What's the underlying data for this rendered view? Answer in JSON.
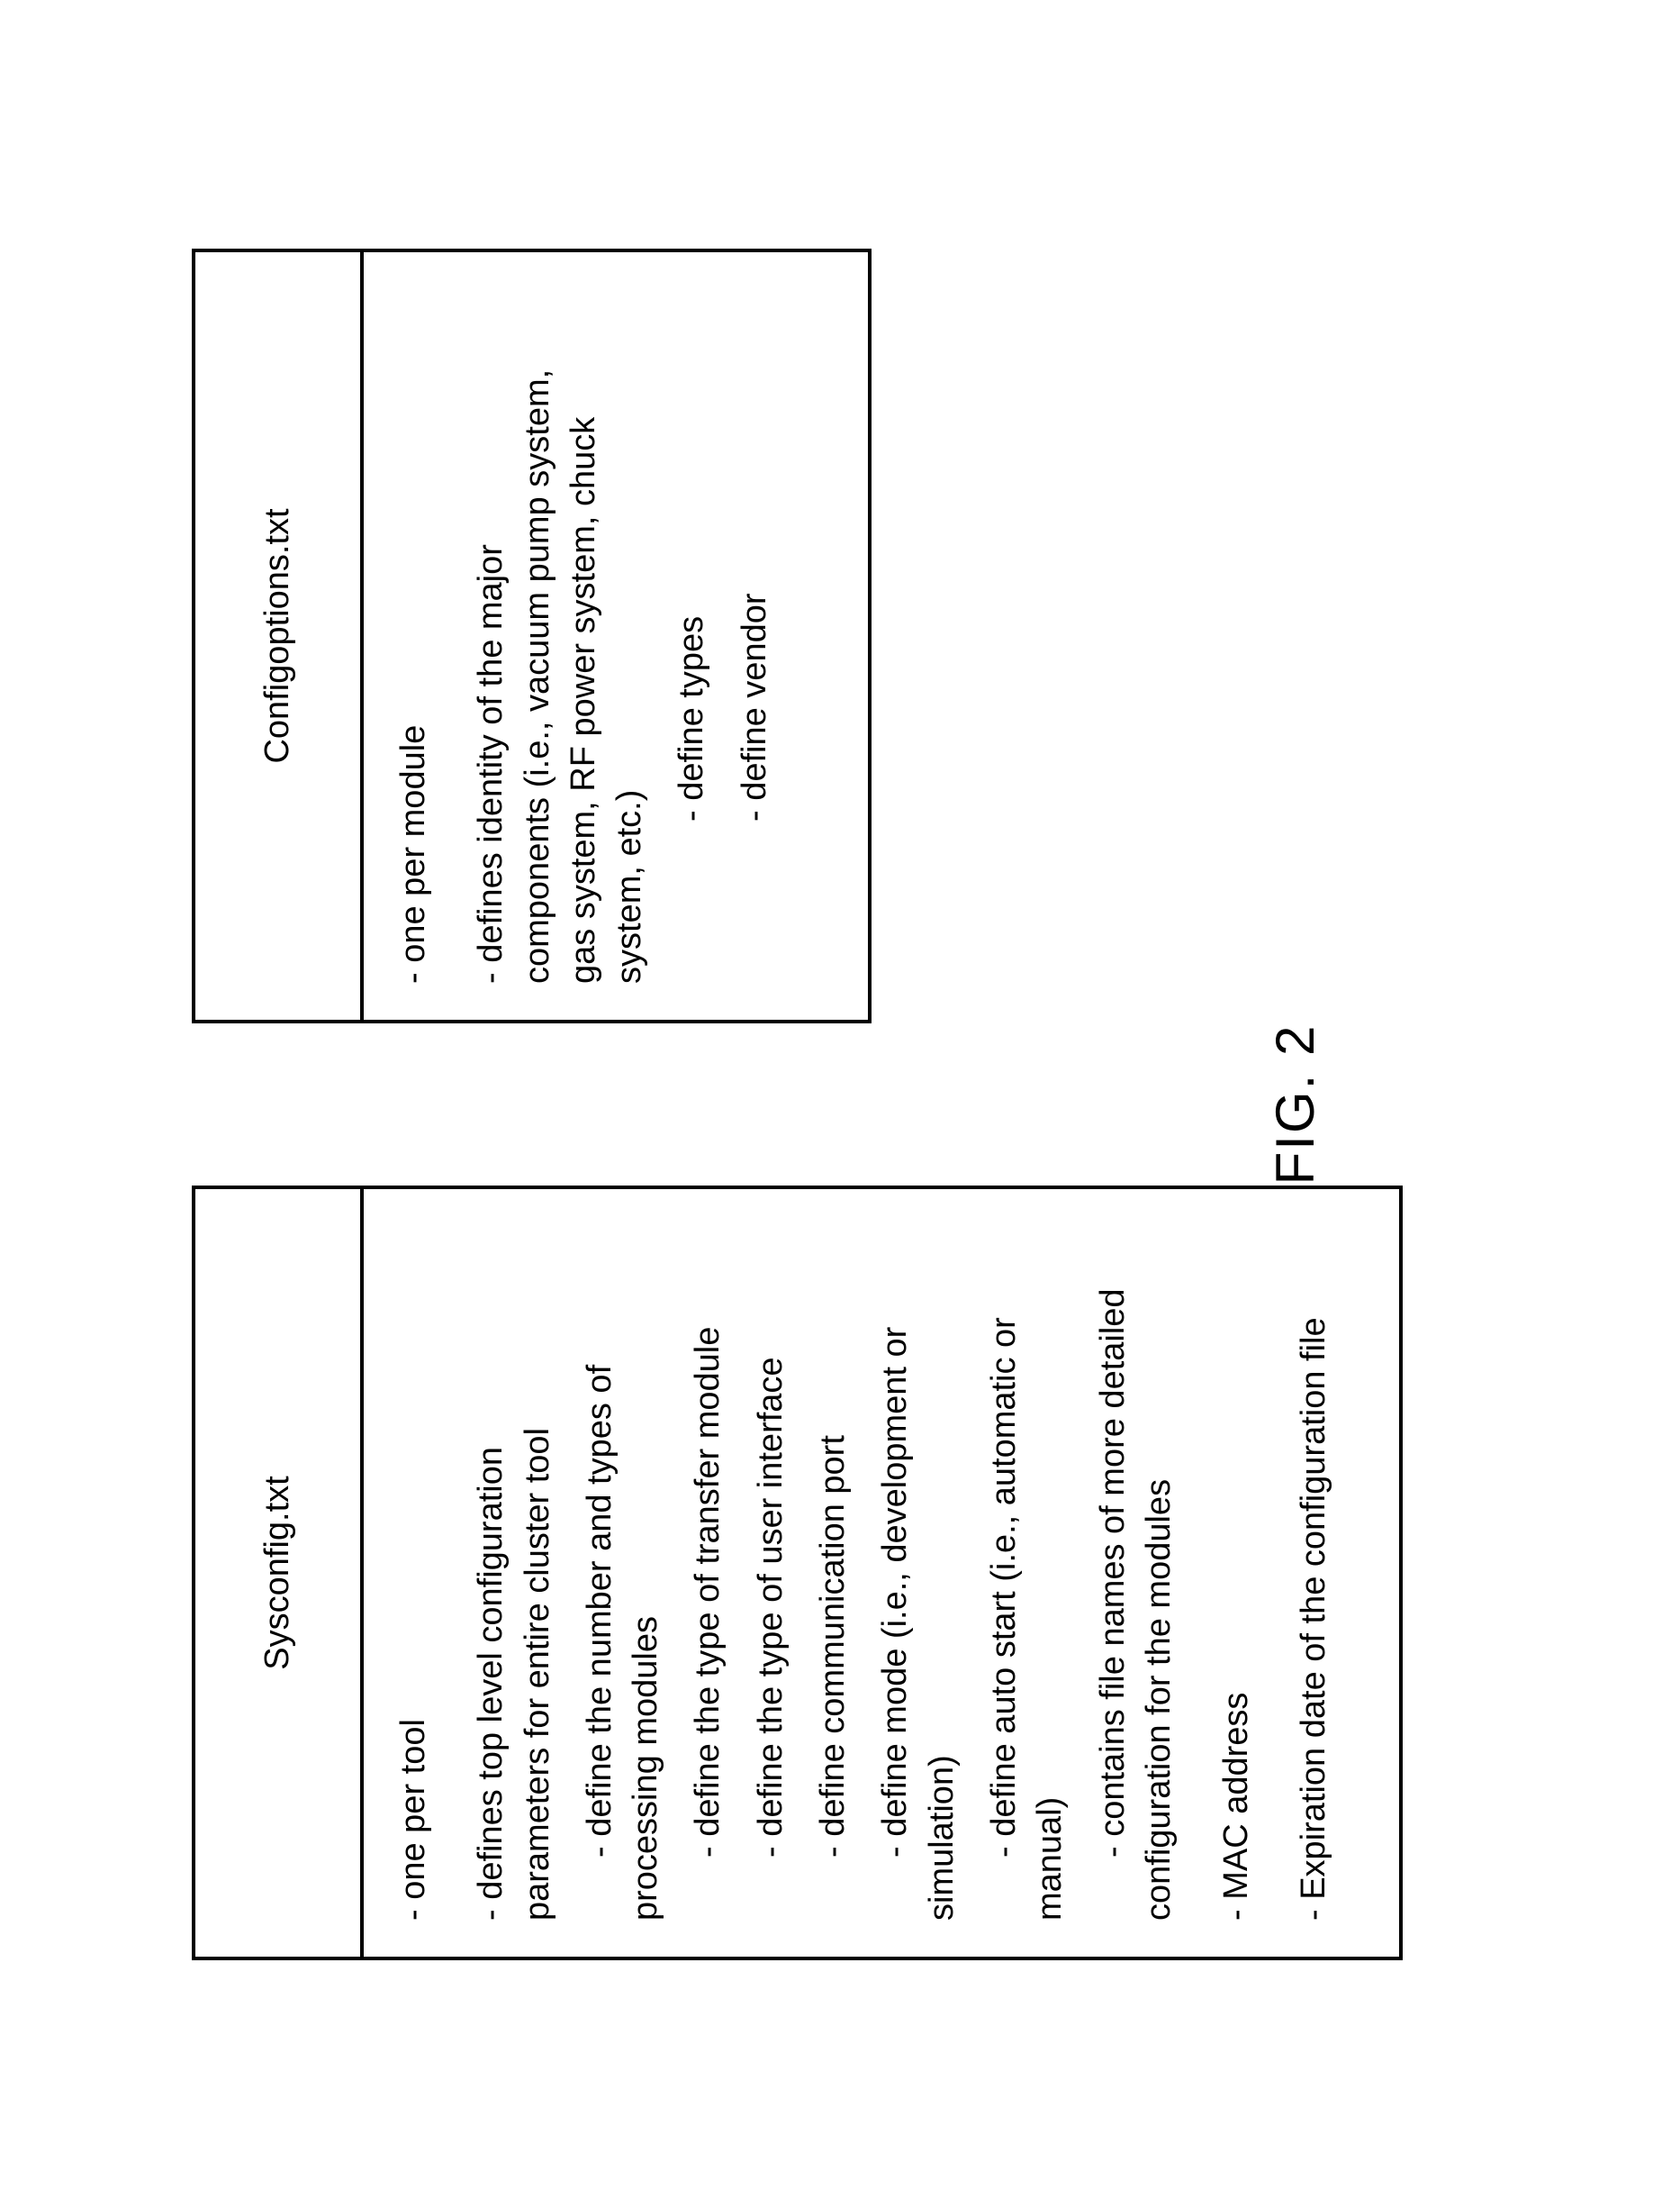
{
  "left": {
    "title": "Sysconfig.txt",
    "line1": "- one per tool",
    "line2a": "- defines top level configuration",
    "line2b": "parameters for entire cluster tool",
    "line3a": "- define the number and types of",
    "line3b": "processing modules",
    "line4": "- define the type of transfer module",
    "line5": "- define the type of user interface",
    "line6": "- define communication port",
    "line7a": "- define mode (i.e., development or",
    "line7b": "simulation)",
    "line8a": "- define auto start (i.e., automatic or",
    "line8b": "manual)",
    "line9a": "- contains file names of more detailed",
    "line9b": "configuration for the modules",
    "line10": "- MAC address",
    "line11": "- Expiration date of the configuration file"
  },
  "right": {
    "title": "Configoptions.txt",
    "line1": "- one per module",
    "line2a": "- defines identity of the major",
    "line2b": "components (i.e., vacuum pump system,",
    "line2c": "gas system, RF power system, chuck",
    "line2d": "system, etc.)",
    "line3": "- define types",
    "line4": "- define vendor"
  },
  "figure_label": "FIG. 2"
}
